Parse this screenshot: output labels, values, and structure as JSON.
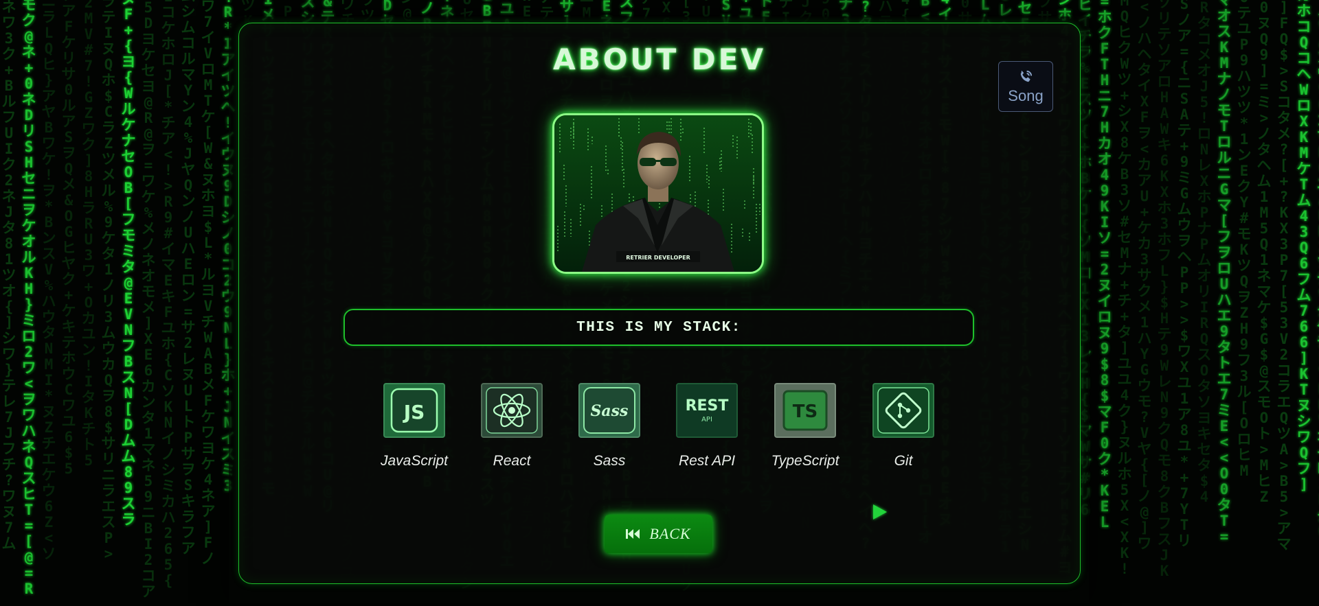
{
  "page": {
    "title": "ABOUT DEV"
  },
  "song_button": {
    "label": "Song",
    "icon": "phone-call-icon"
  },
  "photo": {
    "alt": "Matrix developer portrait",
    "caption": "RETRIER DEVELOPER"
  },
  "stack": {
    "heading": "THIS IS MY STACK:",
    "items": [
      {
        "name": "JavaScript",
        "icon_text": "JS",
        "icon": "javascript-icon"
      },
      {
        "name": "React",
        "icon_text": "",
        "icon": "react-icon"
      },
      {
        "name": "Sass",
        "icon_text": "Sass",
        "icon": "sass-icon"
      },
      {
        "name": "Rest API",
        "icon_text": "REST",
        "icon_subtext": "API",
        "icon": "rest-api-icon"
      },
      {
        "name": "TypeScript",
        "icon_text": "TS",
        "icon": "typescript-icon"
      },
      {
        "name": "Git",
        "icon_text": "",
        "icon": "git-icon"
      }
    ]
  },
  "back_button": {
    "label": "BACK",
    "icon": "rewind-icon"
  },
  "play_button": {
    "icon": "play-icon"
  },
  "colors": {
    "accent": "#1fbf2b",
    "glow": "#3dff4f",
    "rain_bright": "#21e83a",
    "rain_dim": "#0f5a18",
    "background": "#020402"
  }
}
